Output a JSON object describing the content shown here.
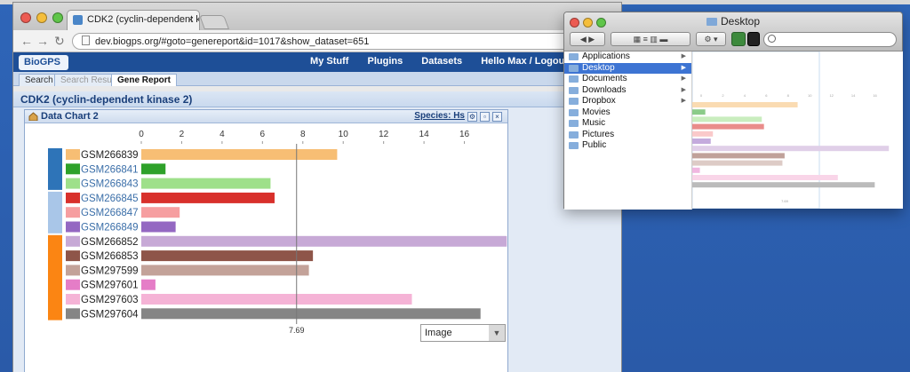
{
  "browser": {
    "tab_title": "CDK2 (cyclin-dependent k",
    "url": "dev.biogps.org/#goto=genereport&id=1017&show_dataset=651",
    "logo": "BioGPS",
    "nav": [
      "My Stuff",
      "Plugins",
      "Datasets",
      "Hello Max / Logout"
    ],
    "tabs": [
      "Search",
      "Search Result",
      "Gene Report"
    ],
    "report_title": "CDK2 (cyclin-dependent kinase 2)",
    "panel_title": "Data Chart 2",
    "species": "Species: Hs",
    "select_value": "Image"
  },
  "chart_data": {
    "type": "bar",
    "orientation": "horizontal",
    "x_ticks": [
      0,
      2,
      4,
      6,
      8,
      10,
      12,
      14,
      16
    ],
    "xlim": [
      0,
      18
    ],
    "mean_line": 7.69,
    "mean_label": "7.69",
    "categories": [
      "GSM266839",
      "GSM266841",
      "GSM266843",
      "GSM266845",
      "GSM266847",
      "GSM266849",
      "GSM266852",
      "GSM266853",
      "GSM297599",
      "GSM297601",
      "GSM297603",
      "GSM297604"
    ],
    "values": [
      9.7,
      1.2,
      6.4,
      6.6,
      1.9,
      1.7,
      18.1,
      8.5,
      8.3,
      0.7,
      13.4,
      16.8
    ],
    "bar_colors": [
      "#f7be74",
      "#2ea12a",
      "#9ee08a",
      "#d8302b",
      "#f69ea0",
      "#9468c2",
      "#c7a9d6",
      "#8e5549",
      "#c3a299",
      "#e57dc7",
      "#f5b3d6",
      "#858585"
    ],
    "label_link_colors": [
      "#222222",
      "#3a6ea8",
      "#3a6ea8",
      "#3a6ea8",
      "#3a6ea8",
      "#3a6ea8",
      "#222222",
      "#222222",
      "#222222",
      "#222222",
      "#222222",
      "#222222"
    ],
    "group_colors": [
      "#2e74b8",
      "#a9c6e8",
      "#fb8513"
    ],
    "group_spans": [
      [
        0,
        3
      ],
      [
        3,
        6
      ],
      [
        6,
        12
      ]
    ]
  },
  "finder": {
    "title": "Desktop",
    "sidebar": [
      "Applications",
      "Desktop",
      "Documents",
      "Downloads",
      "Dropbox",
      "Movies",
      "Music",
      "Pictures",
      "Public"
    ],
    "selected": "Desktop"
  }
}
